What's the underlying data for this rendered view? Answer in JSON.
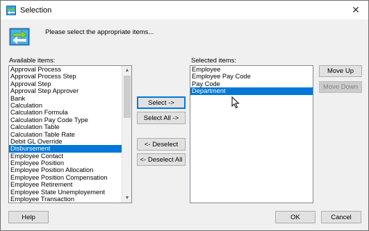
{
  "window": {
    "title": "Selection",
    "close_glyph": "✕"
  },
  "header": {
    "prompt": "Please select the appropriate items..."
  },
  "available": {
    "label": "Available items:",
    "items": [
      "Approval Process",
      "Approval Process Step",
      "Approval Step",
      "Approval Step Approver",
      "Bank",
      "Calculation",
      "Calculation Formula",
      "Calculation Pay Code Type",
      "Calculation Table",
      "Calculation Table Rate",
      "Debit GL Override",
      "Disbursement",
      "Employee Contact",
      "Employee Position",
      "Employee Position Allocation",
      "Employee Position Compensation",
      "Employee Retirement",
      "Employee State Unemployement",
      "Employee Transaction"
    ],
    "selected_item": "Disbursement"
  },
  "selected": {
    "label": "Selected items:",
    "items": [
      "Employee",
      "Employee Pay Code",
      "Pay Code",
      "Department"
    ],
    "selected_item": "Department"
  },
  "buttons": {
    "select": "Select ->",
    "select_all": "Select All ->",
    "deselect": "<- Deselect",
    "deselect_all": "<- Deselect All",
    "move_up": "Move Up",
    "move_down": "Move Down",
    "help": "Help",
    "ok": "OK",
    "cancel": "Cancel"
  },
  "colors": {
    "selection": "#0078d7",
    "face": "#f0f0f0"
  },
  "icons": {
    "title": "selection-swap-icon",
    "header": "selection-swap-icon"
  }
}
